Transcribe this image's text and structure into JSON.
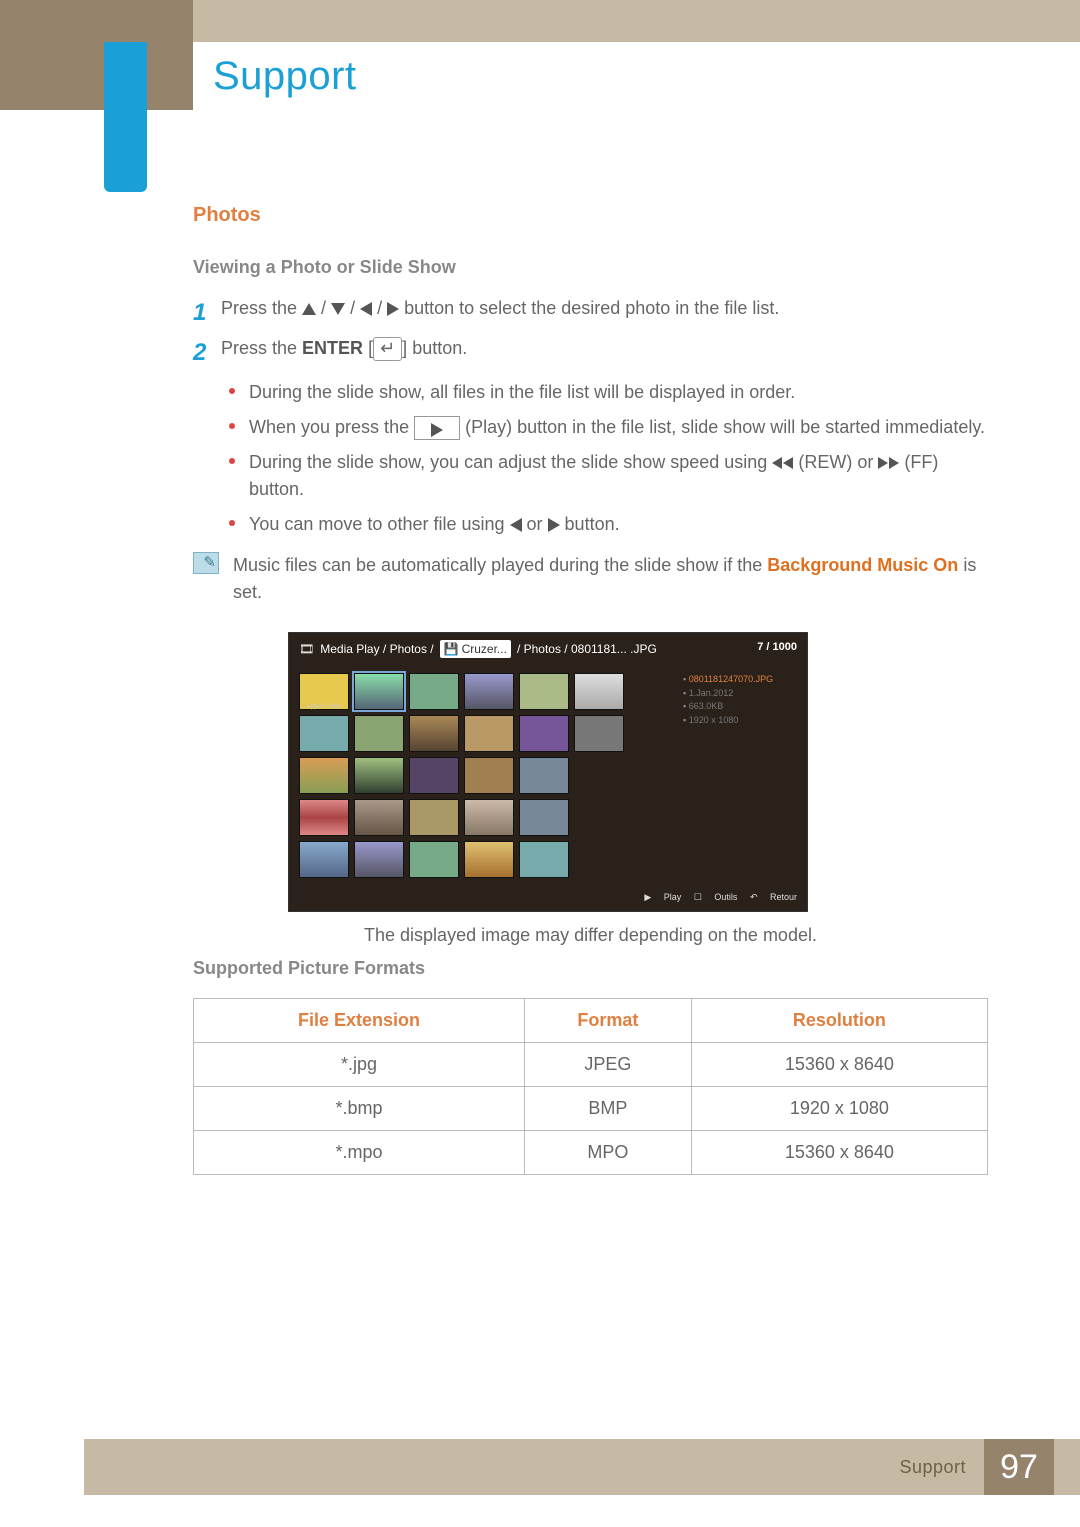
{
  "header": {
    "title": "Support"
  },
  "photos": {
    "heading": "Photos",
    "sub": "Viewing a Photo or Slide Show",
    "step1": {
      "pre": "Press the ",
      "post": " button to select the desired photo in the file list."
    },
    "step2": {
      "pre": "Press the ",
      "enterWord": "ENTER",
      "post": " button."
    },
    "b1": "During the slide show, all files in the file list will be displayed in order.",
    "b2a": "When you press the ",
    "b2b": " (Play) button in the file list, slide show will be started immediately.",
    "b3a": "During the slide show, you can adjust the slide show speed using ",
    "b3_rew": " (REW) or ",
    "b3_ff": " (FF) button.",
    "b4a": "You can move to other file using ",
    "b4_or": " or ",
    "b4b": " button.",
    "note_a": "Music files can be automatically played during the slide show if the ",
    "note_hi": "Background Music On",
    "note_b": " is set."
  },
  "mediaplay": {
    "bc_pre": "Media Play / Photos / ",
    "bc_dev": "Cruzer...",
    "bc_post": " / Photos / 0801181... .JPG",
    "count": "7 / 1000",
    "folderLabel": "Upper Folder",
    "info": {
      "filename": "0801181247070.JPG",
      "date": "1.Jan.2012",
      "size": "663.0KB",
      "res": "1920 x 1080"
    },
    "foot": {
      "play": "Play",
      "outils": "Outils",
      "retour": "Retour"
    },
    "caption": "The displayed image may differ depending on the model."
  },
  "formats": {
    "heading": "Supported Picture Formats",
    "cols": {
      "ext": "File Extension",
      "fmt": "Format",
      "res": "Resolution"
    },
    "rows": [
      {
        "ext": "*.jpg",
        "fmt": "JPEG",
        "res": "15360 x 8640"
      },
      {
        "ext": "*.bmp",
        "fmt": "BMP",
        "res": "1920 x 1080"
      },
      {
        "ext": "*.mpo",
        "fmt": "MPO",
        "res": "15360 x 8640"
      }
    ]
  },
  "footer": {
    "section": "Support",
    "page": "97"
  }
}
